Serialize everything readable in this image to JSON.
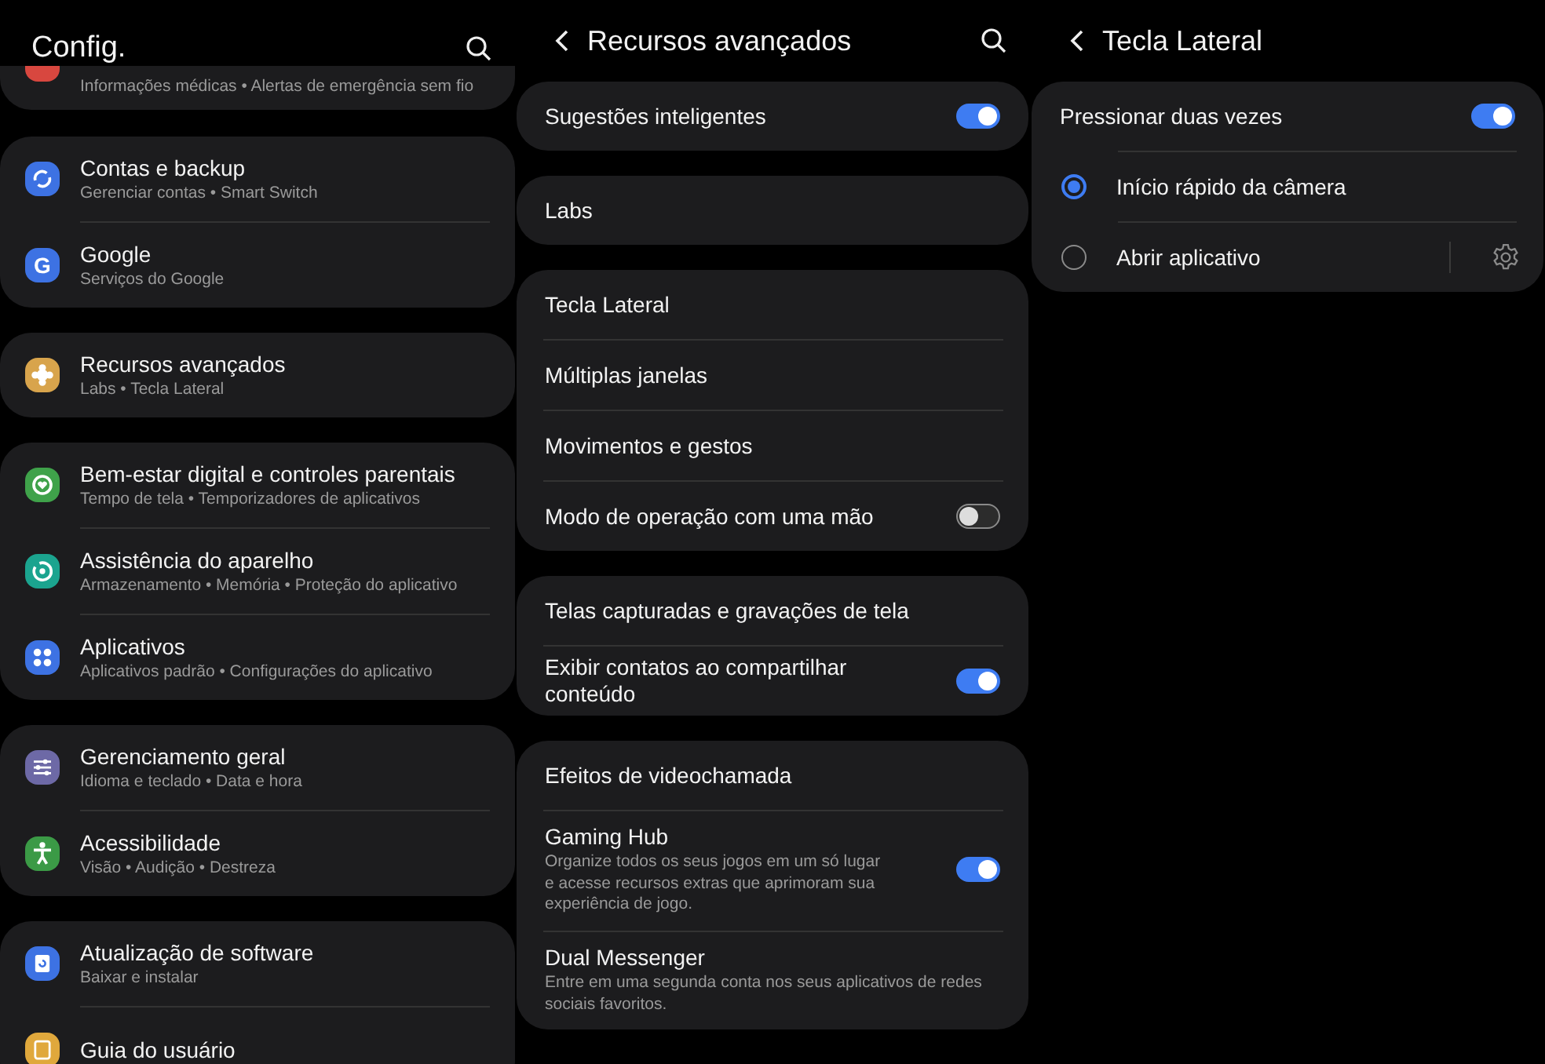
{
  "panels": [
    {
      "title": "Config.",
      "back": false,
      "search": true,
      "groups": [
        {
          "clipped": true,
          "rows": [
            {
              "kind": "nav",
              "color": "#d8473f",
              "subtitle": "Informações médicas • Alertas de emergência sem fio"
            }
          ]
        },
        {
          "rows": [
            {
              "kind": "nav",
              "color": "#3d72e3",
              "title": "Contas e backup",
              "subtitle": "Gerenciar contas • Smart Switch"
            },
            {
              "kind": "nav",
              "color": "#3d72e3",
              "icon_text": "G",
              "title": "Google",
              "subtitle": "Serviços do Google"
            }
          ]
        },
        {
          "rows": [
            {
              "kind": "nav",
              "color": "#d8a44c",
              "title": "Recursos avançados",
              "subtitle": "Labs • Tecla Lateral"
            }
          ]
        },
        {
          "rows": [
            {
              "kind": "nav",
              "color": "#3fa24a",
              "title": "Bem-estar digital e controles parentais",
              "subtitle": "Tempo de tela • Temporizadores de aplicativos"
            },
            {
              "kind": "nav",
              "color": "#1ba48f",
              "title": "Assistência do aparelho",
              "subtitle": "Armazenamento • Memória • Proteção do aplicativo"
            },
            {
              "kind": "nav",
              "color": "#3d72e3",
              "title": "Aplicativos",
              "subtitle": "Aplicativos padrão • Configurações do aplicativo"
            }
          ]
        },
        {
          "rows": [
            {
              "kind": "nav",
              "color": "#6d69a6",
              "title": "Gerenciamento geral",
              "subtitle": "Idioma e teclado • Data e hora"
            },
            {
              "kind": "nav",
              "color": "#3b9a46",
              "title": "Acessibilidade",
              "subtitle": "Visão • Audição • Destreza"
            }
          ]
        },
        {
          "rows": [
            {
              "kind": "nav",
              "color": "#3d72e3",
              "title": "Atualização de software",
              "subtitle": "Baixar e instalar"
            },
            {
              "kind": "nav",
              "color": "#e0a83c",
              "title": "Guia do usuário"
            }
          ]
        }
      ]
    },
    {
      "title": "Recursos avançados",
      "back": true,
      "search": true,
      "groups": [
        {
          "rows": [
            {
              "kind": "toggle",
              "title": "Sugestões inteligentes",
              "on": true
            }
          ]
        },
        {
          "rows": [
            {
              "kind": "plain",
              "title": "Labs"
            }
          ]
        },
        {
          "rows": [
            {
              "kind": "plain",
              "title": "Tecla Lateral"
            },
            {
              "kind": "plain",
              "title": "Múltiplas janelas"
            },
            {
              "kind": "plain",
              "title": "Movimentos e gestos"
            },
            {
              "kind": "toggle",
              "title": "Modo de operação com uma mão",
              "on": false
            }
          ]
        },
        {
          "rows": [
            {
              "kind": "plain",
              "title": "Telas capturadas e gravações de tela"
            },
            {
              "kind": "toggle",
              "title": "Exibir contatos ao compartilhar conteúdo",
              "on": true
            }
          ]
        },
        {
          "rows": [
            {
              "kind": "plain",
              "title": "Efeitos de videochamada"
            },
            {
              "kind": "toggle",
              "title": "Gaming Hub",
              "description": "Organize todos os seus jogos em um só lugar e acesse recursos extras que aprimoram sua experiência de jogo.",
              "on": true
            },
            {
              "kind": "plain",
              "title": "Dual Messenger",
              "description": "Entre em uma segunda conta nos seus aplicativos de redes sociais favoritos."
            }
          ]
        }
      ]
    },
    {
      "title": "Tecla Lateral",
      "back": true,
      "search": false,
      "groups": [
        {
          "rows": [
            {
              "kind": "toggle",
              "title": "Pressionar duas vezes",
              "on": true
            },
            {
              "kind": "radio",
              "title": "Início rápido da câmera",
              "selected": true
            },
            {
              "kind": "radio",
              "title": "Abrir aplicativo",
              "selected": false,
              "settings": true
            }
          ]
        }
      ]
    }
  ]
}
